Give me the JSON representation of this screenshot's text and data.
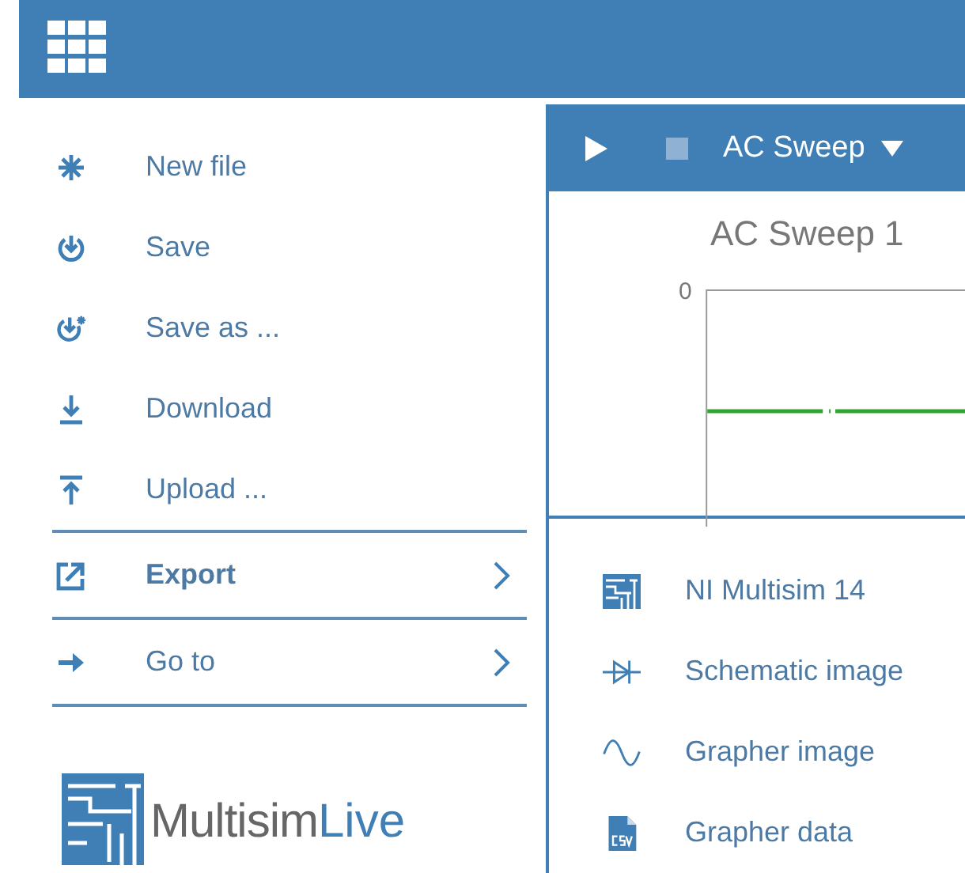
{
  "file_menu": {
    "items": [
      {
        "label": "New file",
        "kind": "action"
      },
      {
        "label": "Save",
        "kind": "action"
      },
      {
        "label": "Save as ...",
        "kind": "action"
      },
      {
        "label": "Download",
        "kind": "action"
      },
      {
        "label": "Upload ...",
        "kind": "action"
      },
      {
        "label": "Export",
        "kind": "submenu",
        "selected": true
      },
      {
        "label": "Go to",
        "kind": "submenu",
        "selected": false
      }
    ],
    "logo": {
      "name": "Multisim",
      "accent": "Live"
    }
  },
  "toolbar": {
    "analysis": "AC Sweep"
  },
  "graph": {
    "title": "AC Sweep 1",
    "y_tick": "0"
  },
  "export_menu": {
    "items": [
      {
        "label": "NI Multisim 14"
      },
      {
        "label": "Schematic image"
      },
      {
        "label": "Grapher image"
      },
      {
        "label": "Grapher data"
      }
    ]
  }
}
